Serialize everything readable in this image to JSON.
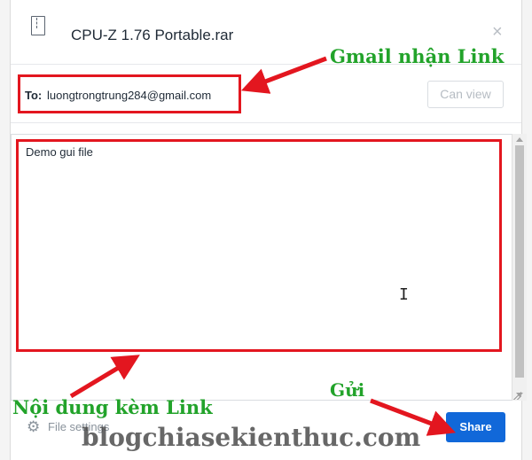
{
  "dialog": {
    "file_title": "CPU-Z 1.76 Portable.rar",
    "close_symbol": "×",
    "icons": {
      "file": "zip-file-icon",
      "close": "close-icon",
      "settings": "gear-icon"
    }
  },
  "recipients": {
    "to_label": "To:",
    "email": "luongtrongtrung284@gmail.com",
    "permission": "Can view"
  },
  "message": {
    "body": "Demo gui file"
  },
  "footer": {
    "settings_link": "File settings",
    "share_label": "Share"
  },
  "annotations": {
    "recipient_note": "Gmail nhận Link",
    "message_note": "Nội dung kèm Link",
    "send_note": "Gửi",
    "watermark": "blogchiasekienthuc.com",
    "highlight_color": "#e3161f",
    "note_color": "#22a32a"
  },
  "colors": {
    "share_button": "#1168d9",
    "text": "#1f2a36"
  }
}
